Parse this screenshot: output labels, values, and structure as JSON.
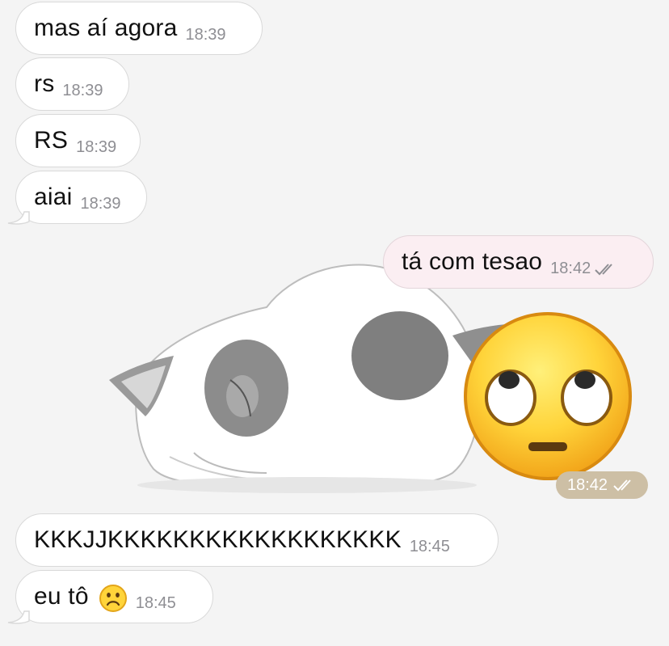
{
  "messages": [
    {
      "text": "mas aí agora",
      "time": "18:39"
    },
    {
      "text": "rs",
      "time": "18:39"
    },
    {
      "text": "RS",
      "time": "18:39"
    },
    {
      "text": "aiai",
      "time": "18:39"
    },
    {
      "text": "tá com tesao",
      "time": "18:42"
    },
    {
      "sticker": "cat-sticker-with-eyeroll-emoji",
      "time": "18:42"
    },
    {
      "text": "KKKJJKKKKKKKKKKKKKKKKKK",
      "time": "18:45"
    },
    {
      "text": "eu tô",
      "emoji": "frowning-face",
      "time": "18:45"
    }
  ],
  "colors": {
    "incoming_bubble": "#ffffff",
    "outgoing_bubble": "#fbeef2",
    "sticker_time_pill": "#cdbfa5"
  }
}
